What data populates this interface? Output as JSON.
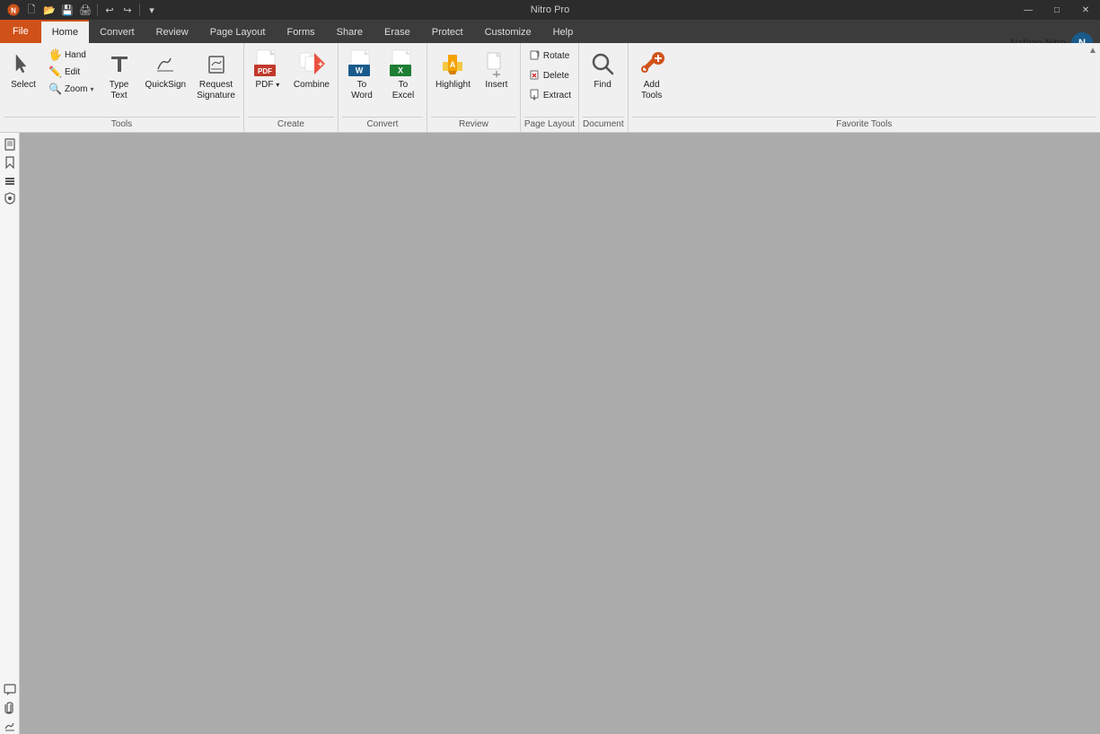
{
  "app": {
    "title": "Nitro Pro"
  },
  "titlebar": {
    "minimize": "—",
    "maximize": "□",
    "close": "✕"
  },
  "quickaccess": {
    "icons": [
      "nitro-logo",
      "new-icon",
      "open-icon",
      "save-icon",
      "print-icon",
      "undo-icon",
      "redo-icon",
      "customize-icon"
    ]
  },
  "tabs": [
    {
      "id": "file",
      "label": "File",
      "active": false,
      "file": true
    },
    {
      "id": "home",
      "label": "Home",
      "active": true
    },
    {
      "id": "convert",
      "label": "Convert",
      "active": false
    },
    {
      "id": "review",
      "label": "Review",
      "active": false
    },
    {
      "id": "pagelayout",
      "label": "Page Layout",
      "active": false
    },
    {
      "id": "forms",
      "label": "Forms",
      "active": false
    },
    {
      "id": "share",
      "label": "Share",
      "active": false
    },
    {
      "id": "erase",
      "label": "Erase",
      "active": false
    },
    {
      "id": "protect",
      "label": "Protect",
      "active": false
    },
    {
      "id": "customize",
      "label": "Customize",
      "active": false
    },
    {
      "id": "help",
      "label": "Help",
      "active": false
    }
  ],
  "user": {
    "name": "Nathan Nitro",
    "avatar_initials": "N"
  },
  "ribbon": {
    "groups": [
      {
        "id": "tools",
        "label": "Tools",
        "buttons": [
          {
            "id": "select",
            "label": "Select",
            "type": "large",
            "icon": "select-icon"
          },
          {
            "id": "tools-stack",
            "type": "stack",
            "items": [
              {
                "id": "hand",
                "label": "Hand",
                "icon": "hand-icon"
              },
              {
                "id": "edit",
                "label": "Edit",
                "icon": "edit-icon"
              },
              {
                "id": "zoom",
                "label": "Zoom",
                "icon": "zoom-icon",
                "has_arrow": true
              }
            ]
          },
          {
            "id": "type-text",
            "label": "Type\nText",
            "type": "large",
            "icon": "type-text-icon"
          },
          {
            "id": "quicksign",
            "label": "QuickSign",
            "type": "large",
            "icon": "quicksign-icon"
          },
          {
            "id": "request-signature",
            "label": "Request\nSignature",
            "type": "large",
            "icon": "request-signature-icon"
          }
        ]
      },
      {
        "id": "create",
        "label": "Create",
        "buttons": [
          {
            "id": "pdf",
            "label": "PDF",
            "type": "large-with-arrow",
            "icon": "pdf-icon"
          },
          {
            "id": "combine",
            "label": "Combine",
            "type": "large",
            "icon": "combine-icon"
          }
        ]
      },
      {
        "id": "convert",
        "label": "Convert",
        "buttons": [
          {
            "id": "to-word",
            "label": "To\nWord",
            "type": "large",
            "icon": "word-icon"
          },
          {
            "id": "to-excel",
            "label": "To\nExcel",
            "type": "large",
            "icon": "excel-icon"
          }
        ]
      },
      {
        "id": "review",
        "label": "Review",
        "buttons": [
          {
            "id": "highlight",
            "label": "Highlight",
            "type": "large",
            "icon": "highlight-icon"
          },
          {
            "id": "insert",
            "label": "Insert",
            "type": "large",
            "icon": "insert-icon"
          }
        ]
      },
      {
        "id": "pagelayout",
        "label": "Page Layout",
        "buttons": [
          {
            "id": "pagelayout-stack",
            "type": "stack",
            "items": [
              {
                "id": "rotate",
                "label": "Rotate",
                "icon": "rotate-icon"
              },
              {
                "id": "delete",
                "label": "Delete",
                "icon": "delete-icon"
              },
              {
                "id": "extract",
                "label": "Extract",
                "icon": "extract-icon"
              }
            ]
          }
        ]
      },
      {
        "id": "document",
        "label": "Document",
        "buttons": [
          {
            "id": "find",
            "label": "Find",
            "type": "large",
            "icon": "find-icon"
          }
        ]
      },
      {
        "id": "favorite-tools",
        "label": "Favorite Tools",
        "buttons": [
          {
            "id": "add-tools",
            "label": "Add\nTools",
            "type": "large",
            "icon": "add-tools-icon"
          }
        ]
      }
    ]
  },
  "sidebar": {
    "top_icons": [
      "pages-icon",
      "bookmarks-icon",
      "layers-icon",
      "security-icon"
    ],
    "bottom_icons": [
      "comments-icon",
      "attachments-icon",
      "signatures-icon"
    ]
  }
}
